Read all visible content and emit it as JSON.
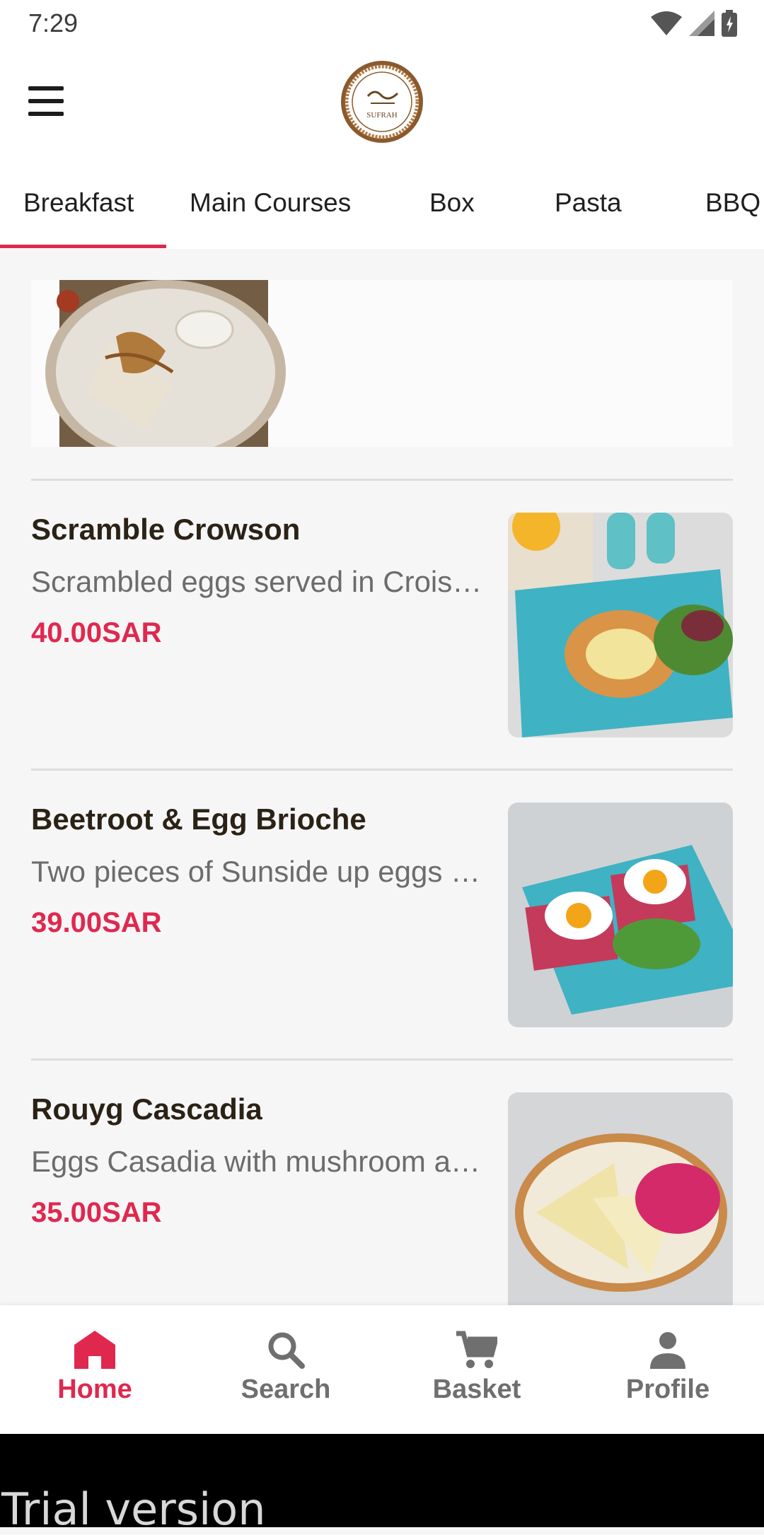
{
  "status": {
    "time": "7:29"
  },
  "header": {
    "logo_text": "SUFRAH"
  },
  "tabs": [
    {
      "label": "Breakfast",
      "active": true
    },
    {
      "label": "Main Courses",
      "active": false
    },
    {
      "label": "Box",
      "active": false
    },
    {
      "label": "Pasta",
      "active": false
    },
    {
      "label": "BBQ",
      "active": false
    }
  ],
  "items": [
    {
      "name": "Scramble Crowson",
      "description": "Scrambled eggs served in Croissant with salad",
      "price": "40.00SAR"
    },
    {
      "name": "Beetroot & Egg Brioche",
      "description": "Two pieces of Sunside up eggs on beetroot brioche",
      "price": "39.00SAR"
    },
    {
      "name": "Rouyg Cascadia",
      "description": "Eggs Casadia with mushroom and cheese",
      "price": "35.00SAR"
    }
  ],
  "nav": [
    {
      "label": "Home",
      "icon": "home-icon",
      "active": true
    },
    {
      "label": "Search",
      "icon": "search-icon",
      "active": false
    },
    {
      "label": "Basket",
      "icon": "cart-icon",
      "active": false
    },
    {
      "label": "Profile",
      "icon": "person-icon",
      "active": false
    }
  ],
  "footer": {
    "trial": "Trial version"
  },
  "colors": {
    "accent": "#e0284f",
    "title": "#2b2216",
    "muted": "#6f6f6f",
    "plate": "#3fb2c4"
  }
}
